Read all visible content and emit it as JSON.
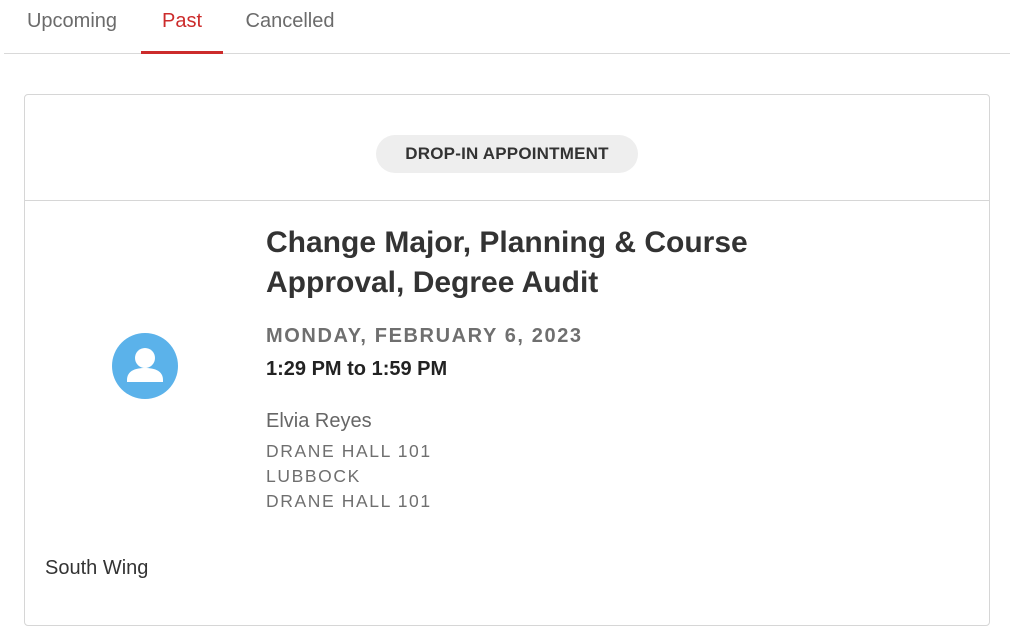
{
  "tabs": {
    "upcoming": "Upcoming",
    "past": "Past",
    "cancelled": "Cancelled",
    "active": "Past"
  },
  "appointment": {
    "type_badge": "DROP-IN APPOINTMENT",
    "title": "Change Major, Planning & Course Approval, Degree Audit",
    "date": "MONDAY, FEBRUARY 6, 2023",
    "time": "1:29 PM to 1:59 PM",
    "advisor": "Elvia Reyes",
    "location_line1": "DRANE HALL 101",
    "location_line2": "LUBBOCK",
    "location_line3": "DRANE HALL 101",
    "note": "South Wing",
    "avatar_icon": "user-icon"
  },
  "colors": {
    "accent": "#cc2b2b",
    "avatar_bg": "#5bb2ea",
    "badge_bg": "#eeeeee",
    "border": "#d6d6d6"
  }
}
